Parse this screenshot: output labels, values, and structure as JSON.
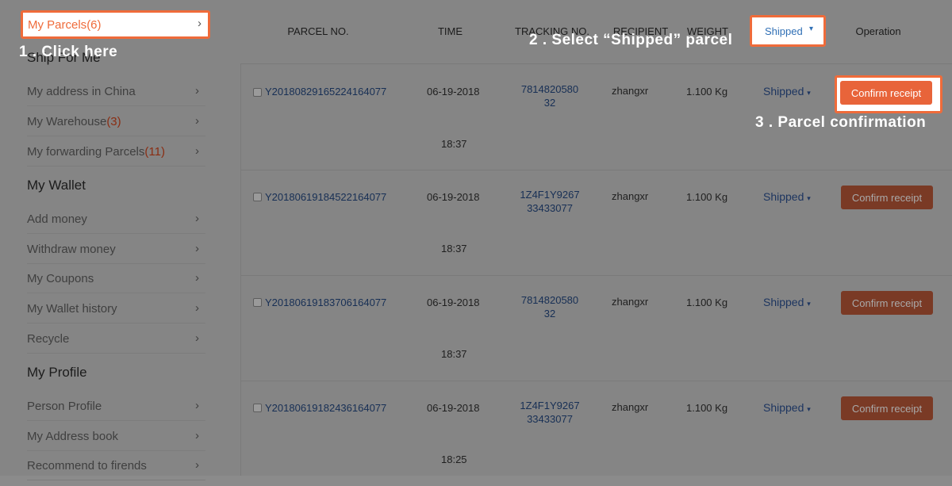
{
  "sidebar": {
    "my_parcels": {
      "label": "My Parcels",
      "count": "(6)"
    },
    "ship_for_me": "Ship For Me",
    "items_ship": [
      {
        "label": "My address in China",
        "count": ""
      },
      {
        "label": "My Warehouse",
        "count": "(3)"
      },
      {
        "label": "My forwarding Parcels",
        "count": "(11)"
      }
    ],
    "wallet_heading": "My Wallet",
    "items_wallet": [
      {
        "label": "Add money"
      },
      {
        "label": "Withdraw money"
      },
      {
        "label": "My Coupons"
      },
      {
        "label": "My Wallet history"
      },
      {
        "label": "Recycle"
      }
    ],
    "profile_heading": "My Profile",
    "items_profile": [
      {
        "label": "Person Profile"
      },
      {
        "label": "My Address book"
      },
      {
        "label": "Recommend to firends"
      }
    ],
    "chevron_icon": "chevron-right-icon"
  },
  "table": {
    "headers": {
      "parcel_no": "PARCEL NO.",
      "time": "TIME",
      "tracking_no": "TRACKING NO.",
      "recipient": "RECIPIENT",
      "weight": "WEIGHT",
      "status_filter": "Shipped",
      "operation": "Operation"
    },
    "rows": [
      {
        "parcel_no": "Y20180829165224164077",
        "date": "06-19-2018",
        "time": "18:37",
        "tracking_1": "7814820580",
        "tracking_2": "32",
        "recipient": "zhangxr",
        "weight": "1.100 Kg",
        "status": "Shipped",
        "action": "Confirm receipt"
      },
      {
        "parcel_no": "Y20180619184522164077",
        "date": "06-19-2018",
        "time": "18:37",
        "tracking_1": "1Z4F1Y9267",
        "tracking_2": "33433077",
        "recipient": "zhangxr",
        "weight": "1.100 Kg",
        "status": "Shipped",
        "action": "Confirm receipt"
      },
      {
        "parcel_no": "Y20180619183706164077",
        "date": "06-19-2018",
        "time": "18:37",
        "tracking_1": "7814820580",
        "tracking_2": "32",
        "recipient": "zhangxr",
        "weight": "1.100 Kg",
        "status": "Shipped",
        "action": "Confirm receipt"
      },
      {
        "parcel_no": "Y20180619182436164077",
        "date": "06-19-2018",
        "time": "18:25",
        "tracking_1": "1Z4F1Y9267",
        "tracking_2": "33433077",
        "recipient": "zhangxr",
        "weight": "1.100 Kg",
        "status": "Shipped",
        "action": "Confirm receipt"
      }
    ]
  },
  "callouts": {
    "step1": "1 . Click here",
    "step2": "2 . Select “Shipped” parcel",
    "step3": "3 . Parcel confirmation"
  },
  "colors": {
    "accent": "#ef6b3a",
    "button": "#e8643a",
    "overlay": "#858585"
  }
}
